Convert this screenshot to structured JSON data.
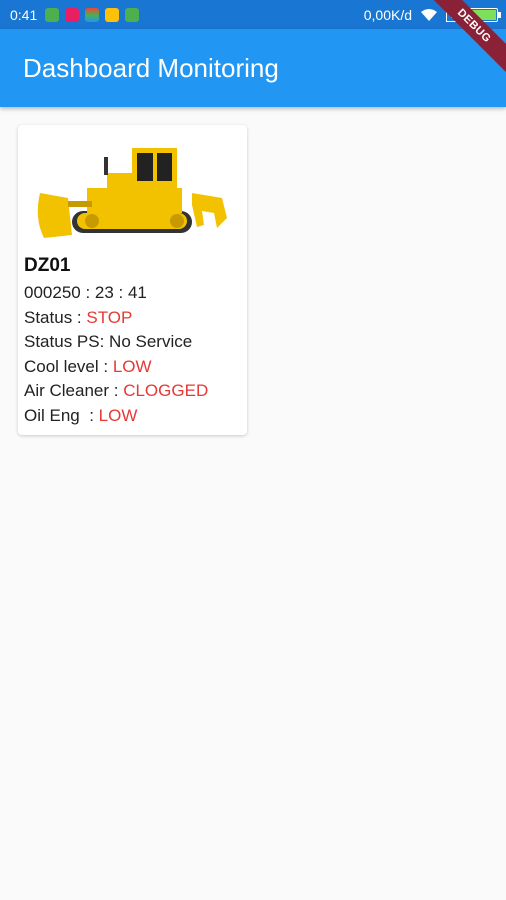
{
  "status_bar": {
    "time": "0:41",
    "network_speed": "0,00K/d",
    "battery_icon": "battery-icon",
    "wifi_icon": "wifi-icon"
  },
  "app_bar": {
    "title": "Dashboard Monitoring",
    "debug_banner": "DEBUG",
    "color": "#2196f3"
  },
  "unit_card": {
    "image_icon": "bulldozer-image",
    "name": "DZ01",
    "hour_meter": "000250 : 23 : 41",
    "status": {
      "label": "Status : ",
      "value": "STOP"
    },
    "status_ps": "Status PS: No Service",
    "cool_level": {
      "label": "Cool level : ",
      "value": "LOW"
    },
    "air_cleaner": {
      "label": "Air Cleaner : ",
      "value": "CLOGGED"
    },
    "oil_eng": {
      "label": "Oil Eng  : ",
      "value": "LOW"
    },
    "alert_color": "#e53935"
  }
}
